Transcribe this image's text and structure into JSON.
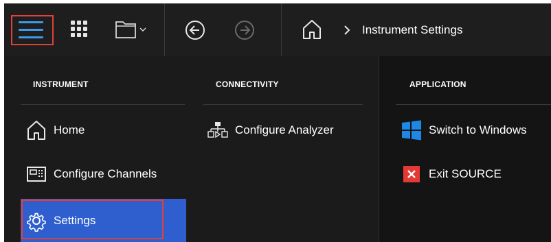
{
  "toolbar": {
    "breadcrumb_current": "Instrument Settings"
  },
  "menu": {
    "instrument": {
      "header": "INSTRUMENT",
      "items": [
        {
          "label": "Home",
          "icon": "home-icon"
        },
        {
          "label": "Configure Channels",
          "icon": "channels-icon"
        },
        {
          "label": "Settings",
          "icon": "gear-icon",
          "selected": true
        }
      ]
    },
    "connectivity": {
      "header": "CONNECTIVITY",
      "items": [
        {
          "label": "Configure Analyzer",
          "icon": "network-icon"
        }
      ]
    },
    "application": {
      "header": "APPLICATION",
      "items": [
        {
          "label": "Switch to Windows",
          "icon": "windows-icon"
        },
        {
          "label": "Exit SOURCE",
          "icon": "close-icon"
        }
      ]
    }
  },
  "colors": {
    "accent_blue": "#3d9aea",
    "selected_bg": "#2f5fcf",
    "highlight_red": "#e0413a",
    "exit_red": "#e53935",
    "windows_blue": "#1e88e5"
  }
}
